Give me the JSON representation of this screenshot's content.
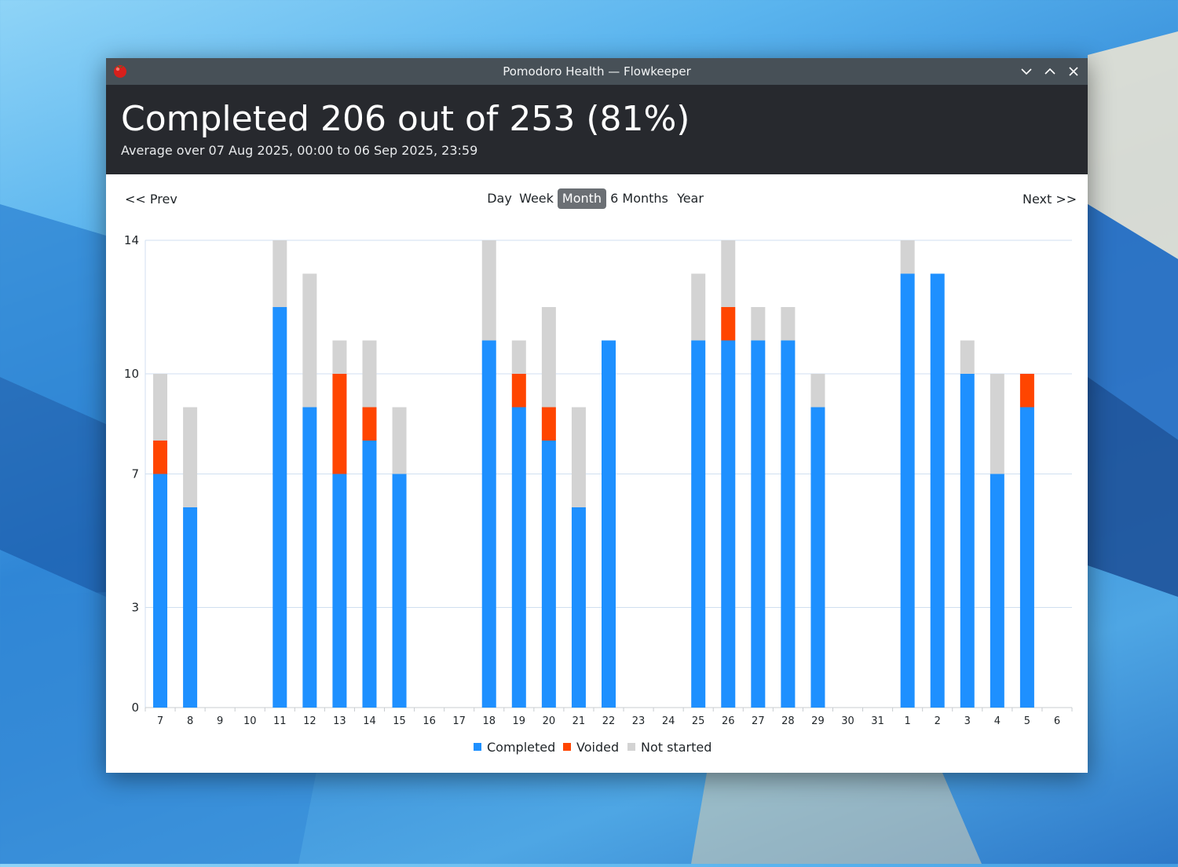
{
  "window": {
    "title": "Pomodoro Health — Flowkeeper",
    "app_icon": "tomato-icon",
    "controls": [
      "minimize-icon",
      "maximize-icon",
      "close-icon"
    ]
  },
  "header": {
    "headline": "Completed 206 out of 253 (81%)",
    "subtitle": "Average over 07 Aug 2025, 00:00 to 06 Sep 2025, 23:59"
  },
  "nav": {
    "prev_label": "<< Prev",
    "next_label": "Next >>",
    "periods": [
      "Day",
      "Week",
      "Month",
      "6 Months",
      "Year"
    ],
    "active_period": "Month"
  },
  "colors": {
    "completed": "#1e90ff",
    "voided": "#ff4500",
    "not_started": "#d3d3d3",
    "grid": "#d0dff0",
    "header_bg": "#27292e",
    "titlebar_bg": "#475057"
  },
  "chart_data": {
    "type": "bar",
    "stacked": true,
    "categories": [
      "7",
      "8",
      "9",
      "10",
      "11",
      "12",
      "13",
      "14",
      "15",
      "16",
      "17",
      "18",
      "19",
      "20",
      "21",
      "22",
      "23",
      "24",
      "25",
      "26",
      "27",
      "28",
      "29",
      "30",
      "31",
      "1",
      "2",
      "3",
      "4",
      "5",
      "6"
    ],
    "series": [
      {
        "name": "Completed",
        "values": [
          7,
          6,
          0,
          0,
          12,
          9,
          7,
          8,
          7,
          0,
          0,
          11,
          9,
          8,
          6,
          11,
          0,
          0,
          11,
          11,
          11,
          11,
          9,
          0,
          0,
          13,
          13,
          10,
          7,
          9,
          0
        ]
      },
      {
        "name": "Voided",
        "values": [
          1,
          0,
          0,
          0,
          0,
          0,
          3,
          1,
          0,
          0,
          0,
          0,
          1,
          1,
          0,
          0,
          0,
          0,
          0,
          1,
          0,
          0,
          0,
          0,
          0,
          0,
          0,
          0,
          0,
          1,
          0
        ]
      },
      {
        "name": "Not started",
        "values": [
          2,
          3,
          0,
          0,
          2,
          4,
          1,
          2,
          2,
          0,
          0,
          3,
          1,
          3,
          3,
          0,
          0,
          0,
          2,
          2,
          1,
          1,
          1,
          0,
          0,
          1,
          0,
          1,
          3,
          0,
          0
        ]
      }
    ],
    "y_ticks": [
      "0",
      "3",
      "7",
      "10",
      "14"
    ],
    "ylim": [
      0,
      14
    ],
    "grid": true,
    "legend_position": "bottom-center"
  }
}
